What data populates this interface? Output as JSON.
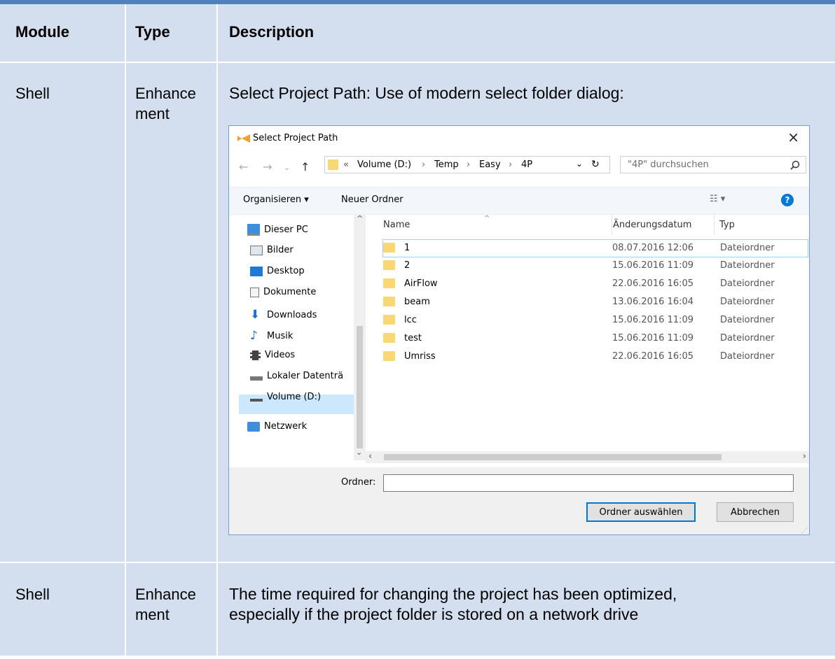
{
  "table": {
    "headers": [
      "Module",
      "Type",
      "Description"
    ],
    "rows": [
      {
        "module": "Shell",
        "type_line1": "Enhance",
        "type_line2": "ment",
        "description": "Select Project Path: Use of modern select folder dialog:"
      },
      {
        "module": "Shell",
        "type_line1": "Enhance",
        "type_line2": "ment",
        "description_line1": "The time required for changing the project has been optimized,",
        "description_line2": "especially if the project folder is stored on a network drive"
      }
    ]
  },
  "dialog": {
    "title": "Select Project Path",
    "breadcrumb": {
      "prefix": "«",
      "parts": [
        "Volume (D:)",
        "Temp",
        "Easy",
        "4P"
      ],
      "separator": "›"
    },
    "search_placeholder": "\"4P\" durchsuchen",
    "organize_label": "Organisieren ▾",
    "new_folder_label": "Neuer Ordner",
    "nav": [
      {
        "label": "Dieser PC",
        "icon": "computer-icon"
      },
      {
        "label": "Bilder",
        "icon": "pictures-icon"
      },
      {
        "label": "Desktop",
        "icon": "desktop-icon"
      },
      {
        "label": "Dokumente",
        "icon": "documents-icon"
      },
      {
        "label": "Downloads",
        "icon": "download-icon"
      },
      {
        "label": "Musik",
        "icon": "music-icon"
      },
      {
        "label": "Videos",
        "icon": "video-icon"
      },
      {
        "label": "Lokaler Datenträ",
        "icon": "drive-icon"
      },
      {
        "label": "Volume (D:)",
        "icon": "drive-icon",
        "selected": true
      },
      {
        "label": "Netzwerk",
        "icon": "network-icon"
      }
    ],
    "columns": {
      "name": "Name",
      "date": "Änderungsdatum",
      "type": "Typ"
    },
    "files": [
      {
        "name": "1",
        "date": "08.07.2016 12:06",
        "type": "Dateiordner"
      },
      {
        "name": "2",
        "date": "15.06.2016 11:09",
        "type": "Dateiordner"
      },
      {
        "name": "AirFlow",
        "date": "22.06.2016 16:05",
        "type": "Dateiordner"
      },
      {
        "name": "beam",
        "date": "13.06.2016 16:04",
        "type": "Dateiordner"
      },
      {
        "name": "lcc",
        "date": "15.06.2016 11:09",
        "type": "Dateiordner"
      },
      {
        "name": "test",
        "date": "15.06.2016 11:09",
        "type": "Dateiordner"
      },
      {
        "name": "Umriss",
        "date": "22.06.2016 16:05",
        "type": "Dateiordner"
      }
    ],
    "folder_label": "Ordner:",
    "folder_value": "",
    "select_button": "Ordner auswählen",
    "cancel_button": "Abbrechen",
    "colors": {
      "folder": "#f8d775",
      "accent": "#0078d7",
      "selected": "#cce8ff"
    }
  }
}
